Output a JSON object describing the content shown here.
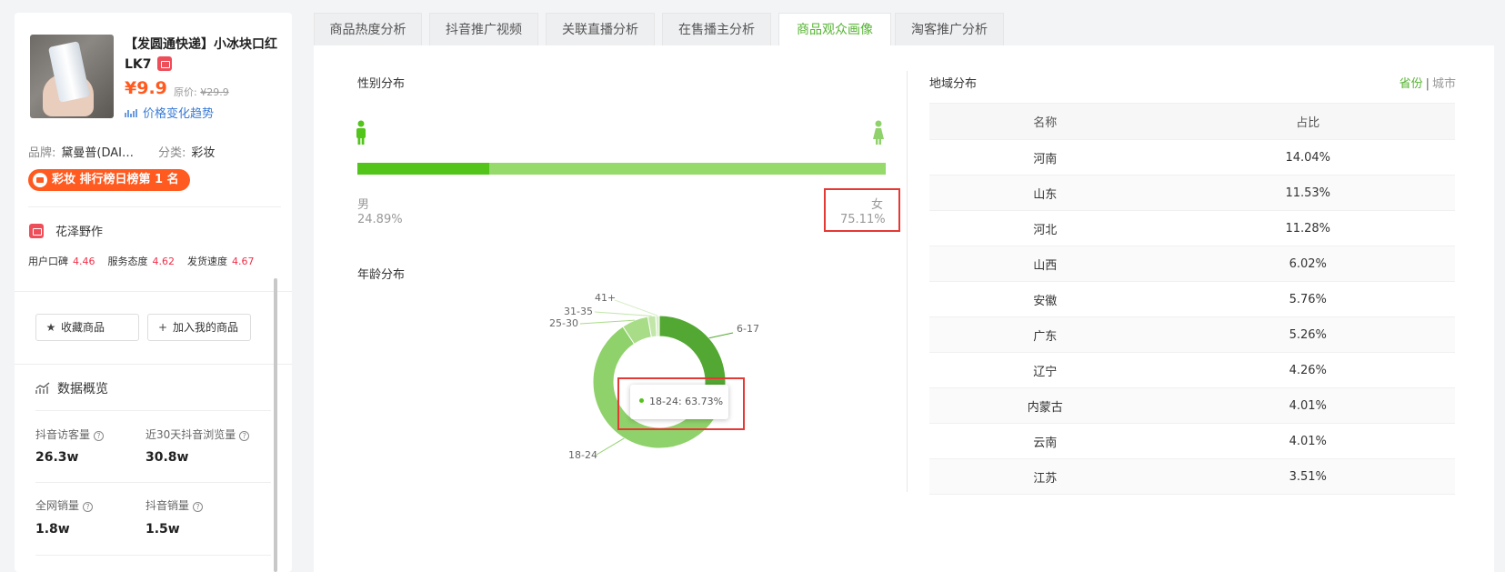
{
  "product": {
    "title": "【发圆通快递】小冰块口红LK7",
    "price": "¥9.9",
    "orig_label": "原价:",
    "orig_price": "¥29.9",
    "trend_link": "价格变化趋势",
    "brand_key": "品牌:",
    "brand_val": "黛曼普(DAI…",
    "cat_key": "分类:",
    "cat_val": "彩妆",
    "rank_text": "彩妆 排行榜日榜第 1 名"
  },
  "store": {
    "name": "花泽野作",
    "scores": [
      {
        "label": "用户口碑",
        "value": "4.46"
      },
      {
        "label": "服务态度",
        "value": "4.62"
      },
      {
        "label": "发货速度",
        "value": "4.67"
      }
    ]
  },
  "actions": {
    "favorite": "收藏商品",
    "add_mine": "加入我的商品"
  },
  "overview": {
    "title": "数据概览",
    "stats": [
      {
        "label": "抖音访客量",
        "value": "26.3w"
      },
      {
        "label": "近30天抖音浏览量",
        "value": "30.8w"
      },
      {
        "label": "全网销量",
        "value": "1.8w"
      },
      {
        "label": "抖音销量",
        "value": "1.5w"
      }
    ]
  },
  "tabs": [
    {
      "label": "商品热度分析",
      "active": false
    },
    {
      "label": "抖音推广视频",
      "active": false
    },
    {
      "label": "关联直播分析",
      "active": false
    },
    {
      "label": "在售播主分析",
      "active": false
    },
    {
      "label": "商品观众画像",
      "active": true
    },
    {
      "label": "淘客推广分析",
      "active": false
    }
  ],
  "gender": {
    "title": "性别分布",
    "male_label": "男",
    "male_pct": "24.89%",
    "female_label": "女",
    "female_pct": "75.11%",
    "male_fraction": 0.2489
  },
  "age": {
    "title": "年龄分布",
    "tooltip": "18-24: 63.73%"
  },
  "region": {
    "title": "地域分布",
    "toggle_province": "省份",
    "toggle_city": "城市",
    "col_name": "名称",
    "col_share": "占比",
    "rows": [
      {
        "name": "河南",
        "share": "14.04%"
      },
      {
        "name": "山东",
        "share": "11.53%"
      },
      {
        "name": "河北",
        "share": "11.28%"
      },
      {
        "name": "山西",
        "share": "6.02%"
      },
      {
        "name": "安徽",
        "share": "5.76%"
      },
      {
        "name": "广东",
        "share": "5.26%"
      },
      {
        "name": "辽宁",
        "share": "4.26%"
      },
      {
        "name": "内蒙古",
        "share": "4.01%"
      },
      {
        "name": "云南",
        "share": "4.01%"
      },
      {
        "name": "江苏",
        "share": "3.51%"
      }
    ]
  },
  "chart_data": {
    "type": "pie",
    "categories": [
      "6-17",
      "18-24",
      "25-30",
      "31-35",
      "41+"
    ],
    "values": [
      27.0,
      63.73,
      6.5,
      1.9,
      0.87
    ],
    "colors": [
      "#52a832",
      "#8fd16a",
      "#a8dc87",
      "#c2e6aa",
      "#d7efc7"
    ],
    "title": "年龄分布"
  }
}
